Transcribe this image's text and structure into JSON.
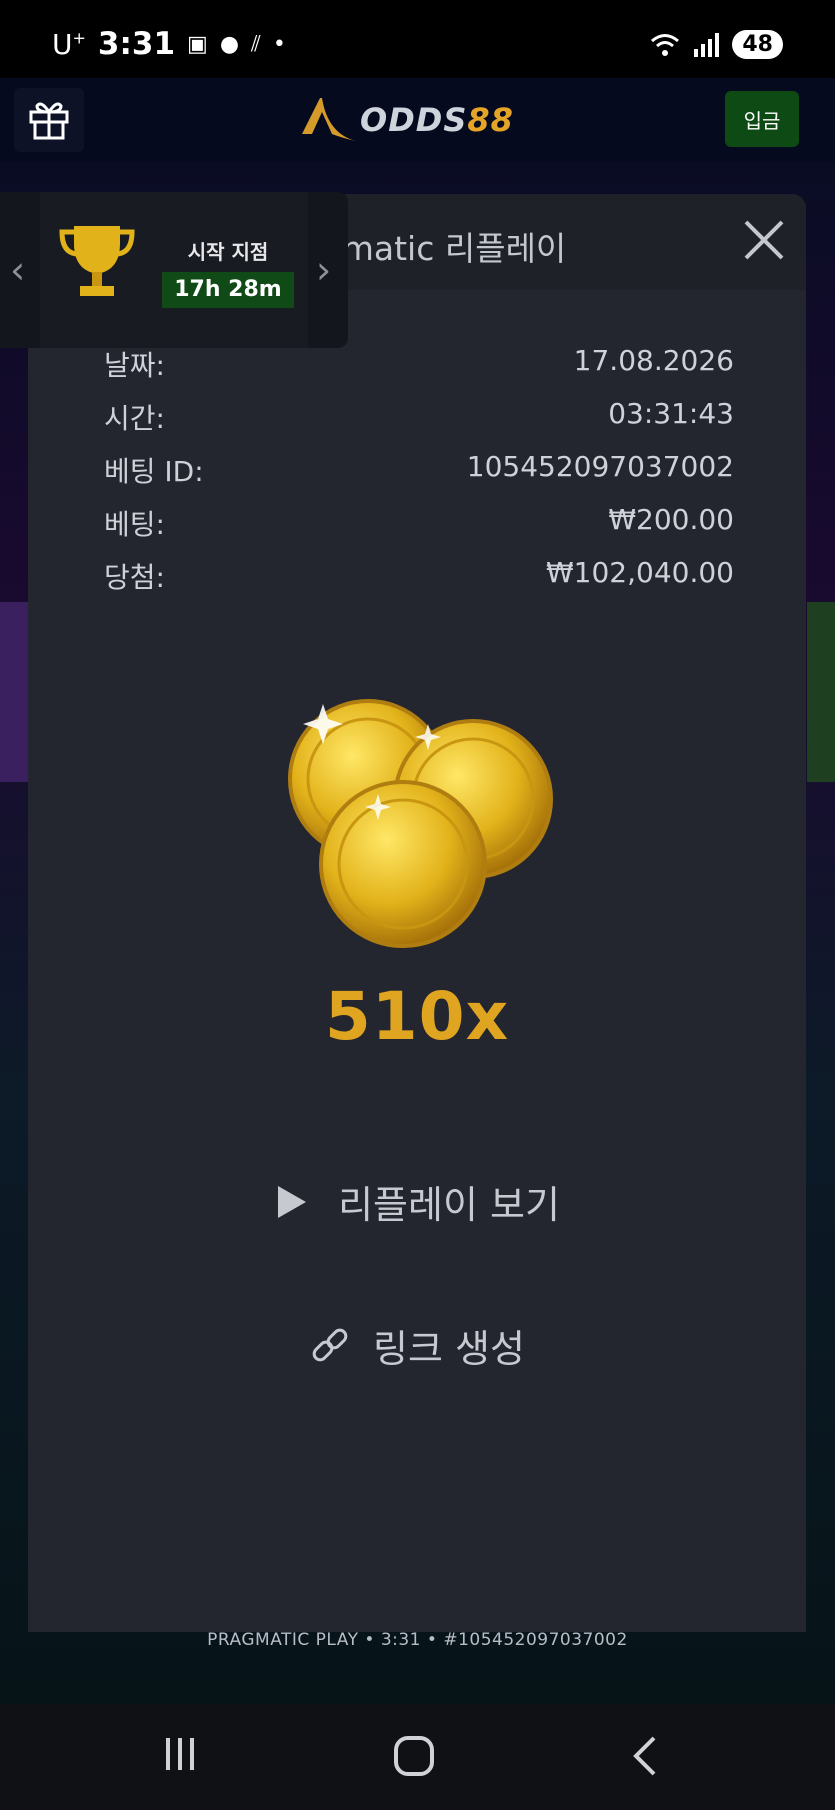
{
  "status_bar": {
    "carrier": "U",
    "carrier_sup": "+",
    "time": "3:31",
    "battery": "48"
  },
  "app_header": {
    "logo_text_a": "ODDS",
    "logo_text_b": "88",
    "deposit_label": "입금"
  },
  "tournament": {
    "label": "시작 지점",
    "timer": "17h 28m"
  },
  "modal": {
    "title": "Pragmatic 리플레이",
    "rows": [
      {
        "label": "날짜:",
        "value": "17.08.2026"
      },
      {
        "label": "시간:",
        "value": "03:31:43"
      },
      {
        "label": "베팅 ID:",
        "value": "105452097037002"
      },
      {
        "label": "베팅:",
        "value": "₩200.00"
      },
      {
        "label": "당첨:",
        "value": "₩102,040.00"
      }
    ],
    "multiplier": "510x",
    "replay_label": "리플레이 보기",
    "link_label": "링크 생성"
  },
  "game_footer": "PRAGMATIC PLAY • 3:31 • #105452097037002",
  "colors": {
    "accent_gold": "#e0a520",
    "deposit_green": "#0e4a14",
    "modal_bg": "#24262f"
  }
}
